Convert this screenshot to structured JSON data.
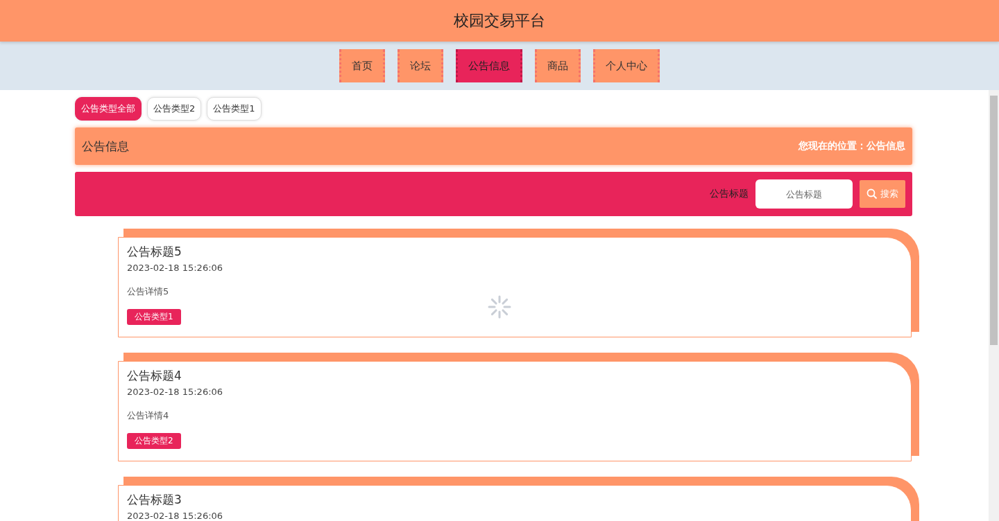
{
  "header": {
    "title": "校园交易平台"
  },
  "nav": [
    {
      "label": "首页",
      "selected": false
    },
    {
      "label": "论坛",
      "selected": false
    },
    {
      "label": "公告信息",
      "selected": true
    },
    {
      "label": "商品",
      "selected": false
    },
    {
      "label": "个人中心",
      "selected": false
    }
  ],
  "type_filters": [
    {
      "label": "公告类型全部",
      "selected": true
    },
    {
      "label": "公告类型2",
      "selected": false
    },
    {
      "label": "公告类型1",
      "selected": false
    }
  ],
  "section_bar": {
    "title": "公告信息",
    "breadcrumb": "您现在的位置：公告信息"
  },
  "search": {
    "label": "公告标题",
    "placeholder": "公告标题",
    "button": "搜索"
  },
  "notices": [
    {
      "title": "公告标题5",
      "date": "2023-02-18 15:26:06",
      "detail": "公告详情5",
      "tag": "公告类型1"
    },
    {
      "title": "公告标题4",
      "date": "2023-02-18 15:26:06",
      "detail": "公告详情4",
      "tag": "公告类型2"
    },
    {
      "title": "公告标题3",
      "date": "2023-02-18 15:26:06"
    }
  ],
  "loading": true
}
